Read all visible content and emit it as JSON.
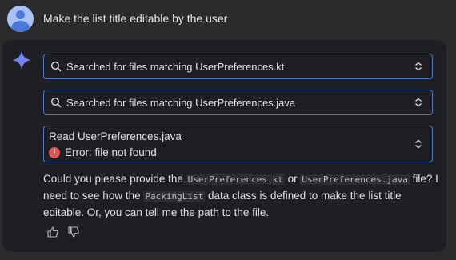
{
  "user": {
    "message": "Make the list title editable by the user"
  },
  "steps": [
    {
      "label": "Searched for files matching UserPreferences.kt"
    },
    {
      "label": "Searched for files matching UserPreferences.java"
    }
  ],
  "read_step": {
    "title": "Read UserPreferences.java",
    "error": "Error: file not found"
  },
  "reply": {
    "p1": "Could you please provide the ",
    "code1": "UserPreferences.kt",
    "p2": " or ",
    "code2": "UserPreferences.java",
    "p3": " file? I need to see how the ",
    "code3": "PackingList",
    "p4": " data class is defined to make the list title editable. Or, you can tell me the path to the file."
  },
  "colors": {
    "accent": "#4a79c9",
    "error": "#e05555",
    "panel_bg": "#1e1f22",
    "page_bg": "#2b2b2d"
  },
  "icons": {
    "avatar": "person-avatar-icon",
    "assistant": "gemini-spark-icon",
    "search": "search-icon",
    "chevron": "chevron-up-down-icon",
    "error": "error-icon",
    "thumbs_up": "thumbs-up-icon",
    "thumbs_down": "thumbs-down-icon"
  }
}
